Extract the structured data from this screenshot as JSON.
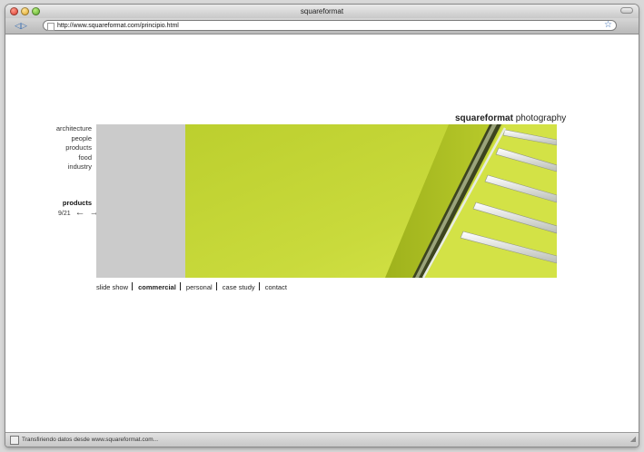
{
  "window": {
    "title": "squareformat"
  },
  "toolbar": {
    "address": "http://www.squareformat.com/principio.html"
  },
  "site": {
    "brand_bold": "squareformat",
    "brand_light": "photography",
    "categories": [
      "architecture",
      "people",
      "products",
      "food",
      "industry"
    ],
    "current_section": "products",
    "counter": "9/21",
    "bottom_nav": [
      "slide show",
      "commercial",
      "personal",
      "case study",
      "contact"
    ],
    "active_nav": "commercial",
    "colors": {
      "photo_accent": "#c5d63a",
      "gray_panel": "#cbcbcb"
    }
  },
  "status": {
    "text": "Transfiriendo datos desde www.squareformat.com..."
  }
}
